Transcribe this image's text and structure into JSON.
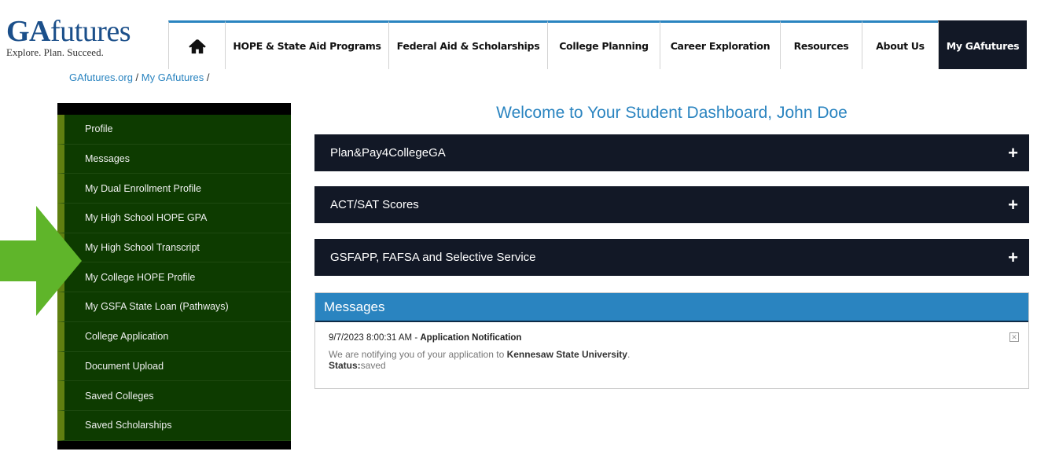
{
  "logo": {
    "brand_bold": "GA",
    "brand_rest": "futures",
    "tagline": "Explore. Plan. Succeed."
  },
  "nav": {
    "items": [
      {
        "label": "HOPE & State Aid Programs"
      },
      {
        "label": "Federal Aid & Scholarships"
      },
      {
        "label": "College Planning"
      },
      {
        "label": "Career Exploration"
      },
      {
        "label": "Resources"
      },
      {
        "label": "About Us"
      },
      {
        "label": "My GAfutures"
      }
    ]
  },
  "breadcrumb": {
    "home": "GAfutures.org",
    "sep1": " / ",
    "current": "My GAfutures",
    "sep2": " /"
  },
  "sidebar": {
    "items": [
      {
        "label": "Profile"
      },
      {
        "label": "Messages"
      },
      {
        "label": "My Dual Enrollment Profile"
      },
      {
        "label": "My High School HOPE GPA"
      },
      {
        "label": "My High School Transcript"
      },
      {
        "label": "My College HOPE Profile"
      },
      {
        "label": "My GSFA State Loan (Pathways)"
      },
      {
        "label": "College Application"
      },
      {
        "label": "Document Upload"
      },
      {
        "label": "Saved Colleges"
      },
      {
        "label": "Saved Scholarships"
      }
    ]
  },
  "main": {
    "welcome": "Welcome to Your Student Dashboard, John Doe",
    "accordions": [
      {
        "label": "Plan&Pay4CollegeGA",
        "icon": "+"
      },
      {
        "label": "ACT/SAT Scores",
        "icon": "+"
      },
      {
        "label": "GSFAPP, FAFSA and Selective Service",
        "icon": "+"
      }
    ],
    "messages": {
      "title": "Messages",
      "item": {
        "timestamp": "9/7/2023 8:00:31 AM",
        "sep": " - ",
        "subject": "Application Notification",
        "body_prefix": "We are notifying you of your application to ",
        "school": "Kennesaw State University",
        "body_suffix": ".",
        "status_label": "Status:",
        "status_value": "saved",
        "close": "✕"
      }
    }
  },
  "colors": {
    "brand_blue": "#2a84c0",
    "nav_dark": "#121826",
    "sidebar_green": "#0d3b00",
    "arrow_green": "#5fb52a"
  }
}
